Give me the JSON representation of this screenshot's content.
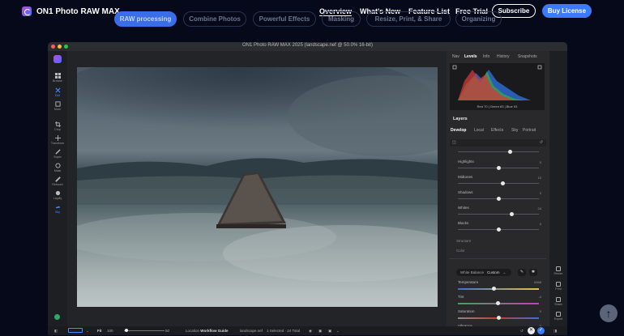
{
  "header": {
    "brand": "ON1 Photo RAW MAX",
    "nav": [
      "Overview",
      "What's New",
      "Feature List",
      "Free Trial"
    ],
    "subscribe": "Subscribe",
    "buy": "Buy License"
  },
  "feature_tabs": [
    "RAW processing",
    "Combine Photos",
    "Powerful Effects",
    "Masking",
    "Resize, Print, & Share",
    "Organizing"
  ],
  "app": {
    "title": "ON1 Photo RAW MAX 2025 (landscape.nef @ 50.0% 16-bit)",
    "left_tools": [
      "Browse",
      "Edit",
      "More",
      "Crop",
      "Transform",
      "Super",
      "Mask",
      "Retouch",
      "Liquify",
      "Sky"
    ],
    "panel_tabs": [
      "Nav",
      "Levels",
      "Info",
      "History",
      "Snapshots"
    ],
    "histogram_readout": "Red 70 | Green 83 | Blue 93",
    "layers_heading": "Layers",
    "develop_tabs": [
      "Develop",
      "Local",
      "Effects",
      "Sky",
      "Portrait"
    ],
    "sliders": [
      {
        "label": "Highlights",
        "value": "0",
        "level": 0.5
      },
      {
        "label": "Midtones",
        "value": "10",
        "level": 0.55
      },
      {
        "label": "Shadows",
        "value": "0",
        "level": 0.5
      },
      {
        "label": "Whites",
        "value": "24",
        "level": 0.66
      },
      {
        "label": "Blacks",
        "value": "0",
        "level": 0.5
      }
    ],
    "structure_label": "Structure",
    "color_label": "Color",
    "white_balance_label": "White Balance",
    "white_balance_value": "Custom",
    "color_sliders": [
      {
        "label": "Temperature",
        "value": "5468",
        "level": 0.44
      },
      {
        "label": "Tint",
        "value": "-4",
        "level": 0.49
      },
      {
        "label": "Saturation",
        "value": "0",
        "level": 0.5
      },
      {
        "label": "Vibrance",
        "value": "0",
        "level": 0.5
      }
    ],
    "right_tools": [
      "Resize",
      "Print",
      "Share",
      "Export"
    ],
    "status": {
      "fit": "Fit",
      "zoom": "100",
      "zoom_max": "50",
      "location_prefix": "Location",
      "location": "Workflow Guide",
      "file": "landscape.nef",
      "selection": "1 Selected · 24 Total"
    }
  },
  "colors": {
    "accent": "#3b7bff",
    "background": "#05091a"
  },
  "icons": [
    "chevron-up-icon",
    "grid-icon",
    "eye-icon",
    "undo-icon",
    "close-icon"
  ]
}
